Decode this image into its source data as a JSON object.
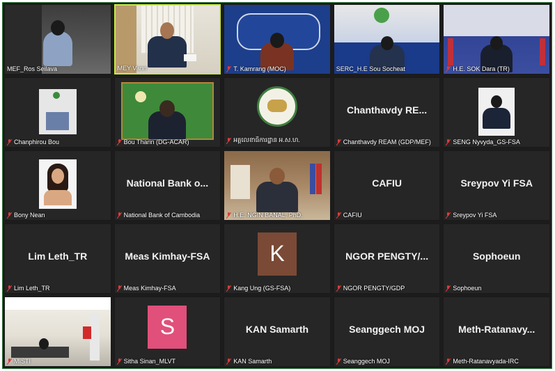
{
  "icons": {
    "mic_muted": "mic-muted-icon"
  },
  "colors": {
    "tile_bg": "#262626",
    "active_border": "#c9e84a",
    "frame_border": "#2a7a3a"
  },
  "tiles": [
    {
      "label": "MEF_Ros Seilava",
      "center": ""
    },
    {
      "label": "MEY Vann",
      "center": ""
    },
    {
      "label": "T. Kamrang (MOC)",
      "center": ""
    },
    {
      "label": "SERC_H.E Sou Socheat",
      "center": ""
    },
    {
      "label": "H.E. SOK Dara (TR)",
      "center": ""
    },
    {
      "label": "Chanphirou Bou",
      "center": ""
    },
    {
      "label": "Bou Tharin (DG-ACAR)",
      "center": ""
    },
    {
      "label": "អគ្គលេខាធិការដ្ឋាន អ.ស.ហ.",
      "center": ""
    },
    {
      "label": "Chanthavdy REAM (GDP/MEF)",
      "center": "Chanthavdy RE..."
    },
    {
      "label": "SENG Nyvyda_GS-FSA",
      "center": ""
    },
    {
      "label": "Bony Nean",
      "center": ""
    },
    {
      "label": "National Bank of Cambodia",
      "center": "National Bank o..."
    },
    {
      "label": "H.E. NGIN BANAL, PhD.",
      "center": ""
    },
    {
      "label": "CAFIU",
      "center": "CAFIU"
    },
    {
      "label": "Sreypov Yi FSA",
      "center": "Sreypov Yi FSA"
    },
    {
      "label": "Lim Leth_TR",
      "center": "Lim Leth_TR"
    },
    {
      "label": "Meas Kimhay-FSA",
      "center": "Meas Kimhay-FSA"
    },
    {
      "label": "Kang Ung (GS-FSA)",
      "center": "",
      "avatar": "K",
      "avatar_color": "#7a4a36"
    },
    {
      "label": "NGOR PENGTY/GDP",
      "center": "NGOR PENGTY/..."
    },
    {
      "label": "Sophoeun",
      "center": "Sophoeun"
    },
    {
      "label": "MISTI",
      "center": ""
    },
    {
      "label": "Sitha Sinan_MLVT",
      "center": "",
      "avatar": "S",
      "avatar_color": "#e0507a"
    },
    {
      "label": "KAN Samarth",
      "center": "KAN Samarth"
    },
    {
      "label": "Seanggech MOJ",
      "center": "Seanggech MOJ"
    },
    {
      "label": "Meth-Ratanavyada-IRC",
      "center": "Meth-Ratanavy..."
    }
  ]
}
